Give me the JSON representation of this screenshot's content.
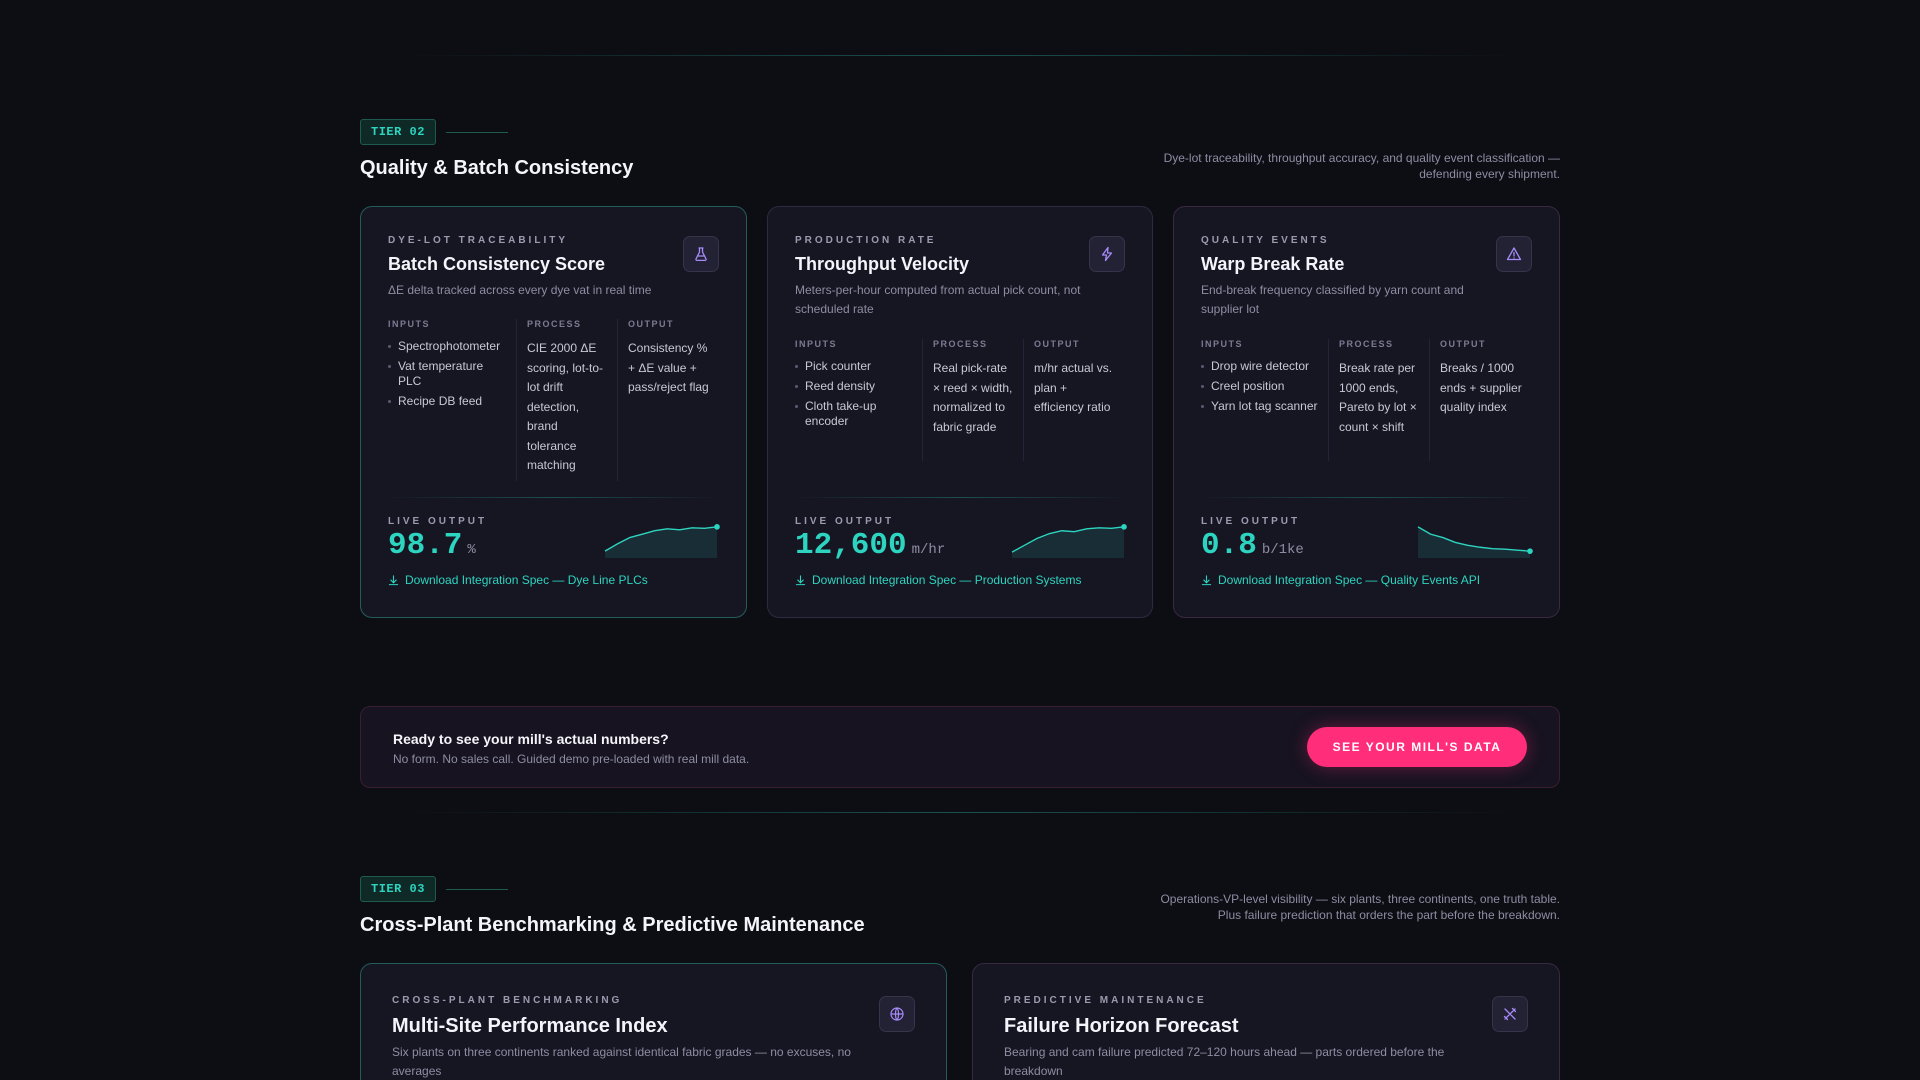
{
  "tier2": {
    "badge": "TIER 02",
    "title": "Quality & Batch Consistency",
    "description": "Dye-lot traceability, throughput accuracy, and quality event classification — defending every shipment.",
    "cards": [
      {
        "eyebrow": "DYE-LOT TRACEABILITY",
        "title": "Batch Consistency Score",
        "desc": "ΔE delta tracked across every dye vat in real time",
        "icon": "flask-icon",
        "inputs_label": "INPUTS",
        "process_label": "PROCESS",
        "output_label": "OUTPUT",
        "inputs": [
          "Spectrophotometer",
          "Vat temperature PLC",
          "Recipe DB feed"
        ],
        "process": "CIE 2000 ΔE scoring, lot-to-lot drift detection, brand tolerance matching",
        "output": "Consistency % + ΔE value + pass/reject flag",
        "live_label": "LIVE OUTPUT",
        "value": "98.7",
        "unit": "%",
        "link": "Download Integration Spec — Dye Line PLCs",
        "trend": [
          20,
          35,
          48,
          55,
          62,
          66,
          64,
          68,
          67,
          70
        ]
      },
      {
        "eyebrow": "PRODUCTION RATE",
        "title": "Throughput Velocity",
        "desc": "Meters-per-hour computed from actual pick count, not scheduled rate",
        "icon": "lightning-icon",
        "inputs_label": "INPUTS",
        "process_label": "PROCESS",
        "output_label": "OUTPUT",
        "inputs": [
          "Pick counter",
          "Reed density",
          "Cloth take-up encoder"
        ],
        "process": "Real pick-rate × reed × width, normalized to fabric grade",
        "output": "m/hr actual vs. plan + efficiency ratio",
        "live_label": "LIVE OUTPUT",
        "value": "12,600",
        "unit": "m/hr",
        "link": "Download Integration Spec — Production Systems",
        "trend": [
          18,
          32,
          46,
          56,
          62,
          60,
          66,
          68,
          67,
          70
        ]
      },
      {
        "eyebrow": "QUALITY EVENTS",
        "title": "Warp Break Rate",
        "desc": "End-break frequency classified by yarn count and supplier lot",
        "icon": "warning-icon",
        "inputs_label": "INPUTS",
        "process_label": "PROCESS",
        "output_label": "OUTPUT",
        "inputs": [
          "Drop wire detector",
          "Creel position",
          "Yarn lot tag scanner"
        ],
        "process": "Break rate per 1000 ends, Pareto by lot × count × shift",
        "output": "Breaks / 1000 ends + supplier quality index",
        "live_label": "LIVE OUTPUT",
        "value": "0.8",
        "unit": "b/1ke",
        "link": "Download Integration Spec — Quality Events API",
        "trend": [
          70,
          55,
          48,
          38,
          32,
          28,
          25,
          24,
          22,
          20
        ]
      }
    ]
  },
  "cta": {
    "title": "Ready to see your mill's actual numbers?",
    "subtitle": "No form. No sales call. Guided demo pre-loaded with real mill data.",
    "button": "SEE YOUR MILL'S DATA"
  },
  "tier3": {
    "badge": "TIER 03",
    "title": "Cross-Plant Benchmarking & Predictive Maintenance",
    "description": "Operations-VP-level visibility — six plants, three continents, one truth table. Plus failure prediction that orders the part before the breakdown.",
    "cards": [
      {
        "eyebrow": "CROSS-PLANT BENCHMARKING",
        "title": "Multi-Site Performance Index",
        "desc": "Six plants on three continents ranked against identical fabric grades — no excuses, no averages",
        "icon": "globe-icon"
      },
      {
        "eyebrow": "PREDICTIVE MAINTENANCE",
        "title": "Failure Horizon Forecast",
        "desc": "Bearing and cam failure predicted 72–120 hours ahead — parts ordered before the breakdown",
        "icon": "tools-icon"
      }
    ]
  },
  "colors": {
    "accent": "#2dd4bf",
    "cta": "#ff2d7a",
    "background": "#0d0d14",
    "card": "#161623"
  }
}
